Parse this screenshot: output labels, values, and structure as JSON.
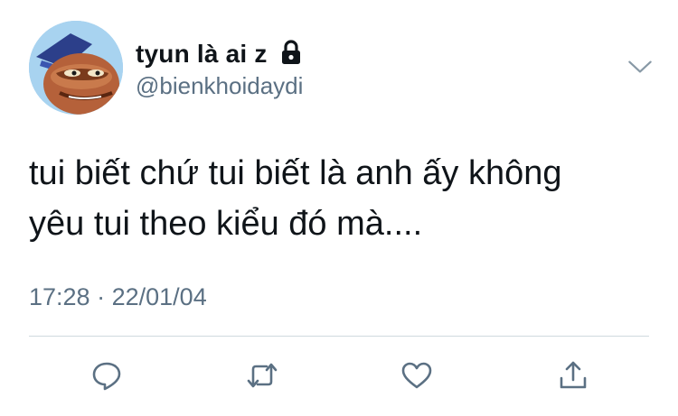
{
  "user": {
    "display_name": "tyun là ai z",
    "handle": "@bienkhoidaydi",
    "locked": true
  },
  "icons": {
    "lock": "lock-icon",
    "caret": "chevron-down-icon",
    "reply": "reply-icon",
    "retweet": "retweet-icon",
    "like": "heart-icon",
    "share": "share-icon"
  },
  "tweet": {
    "text_lines": [
      "tui biết chứ tui biết là anh ấy không",
      "yêu tui theo kiểu đó mà...."
    ],
    "time": "17:28",
    "separator": "·",
    "date": "22/01/04"
  },
  "colors": {
    "text": "#0f1419",
    "secondary": "#5b7083",
    "divider": "#cfd9de",
    "accent": "#1da1f2"
  }
}
